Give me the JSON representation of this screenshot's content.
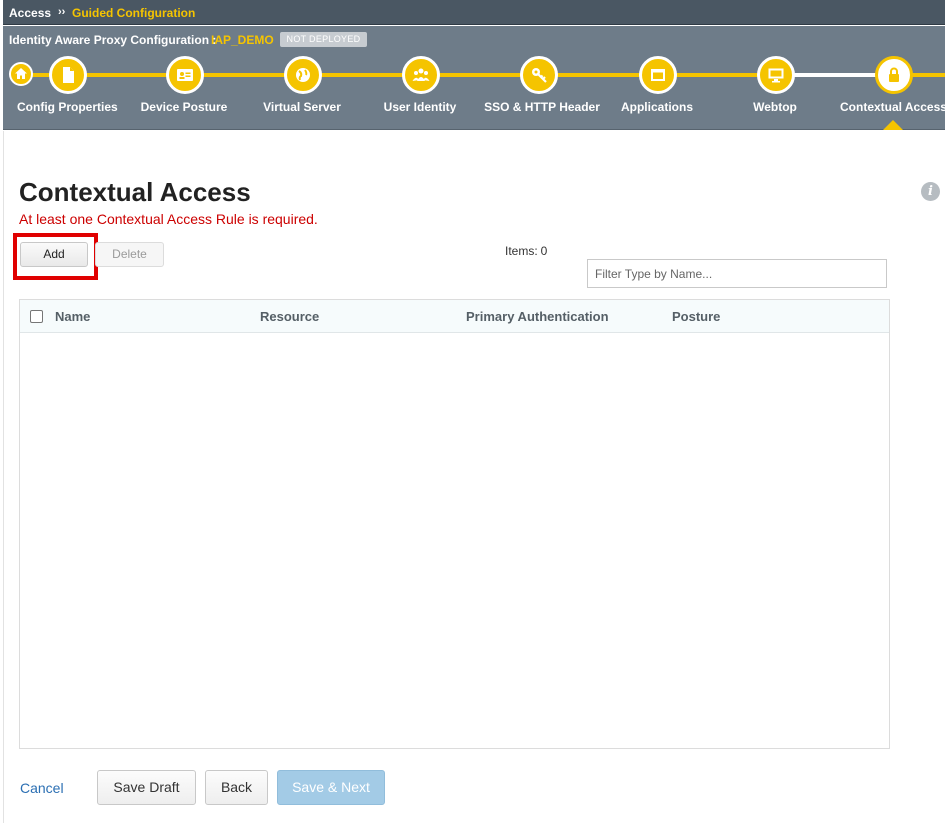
{
  "breadcrumb": {
    "root": "Access",
    "separator": "››",
    "current": "Guided Configuration"
  },
  "wizard": {
    "title": "Identity Aware Proxy Configuration :",
    "config_name": "IAP_DEMO",
    "status_badge": "NOT DEPLOYED",
    "steps": [
      {
        "label": "Config Properties",
        "icon": "document-icon"
      },
      {
        "label": "Device Posture",
        "icon": "id-card-icon"
      },
      {
        "label": "Virtual Server",
        "icon": "globe-icon"
      },
      {
        "label": "User Identity",
        "icon": "users-icon"
      },
      {
        "label": "SSO & HTTP Header",
        "icon": "key-icon"
      },
      {
        "label": "Applications",
        "icon": "window-icon"
      },
      {
        "label": "Webtop",
        "icon": "monitor-icon"
      },
      {
        "label": "Contextual Access",
        "icon": "lock-icon"
      }
    ],
    "active_step": "Contextual Access"
  },
  "main": {
    "title": "Contextual Access",
    "error": "At least one Contextual Access Rule is required.",
    "add_label": "Add",
    "delete_label": "Delete",
    "items_label": "Items:",
    "items_count": "0",
    "filter_placeholder": "Filter Type by Name...",
    "columns": [
      "Name",
      "Resource",
      "Primary Authentication",
      "Posture"
    ]
  },
  "footer": {
    "cancel": "Cancel",
    "save_draft": "Save Draft",
    "back": "Back",
    "save_next": "Save & Next"
  },
  "colors": {
    "accent": "#f5c400",
    "header": "#6e7c89",
    "error": "#cc0000",
    "link": "#2b6fb3",
    "highlight": "#e00000"
  }
}
